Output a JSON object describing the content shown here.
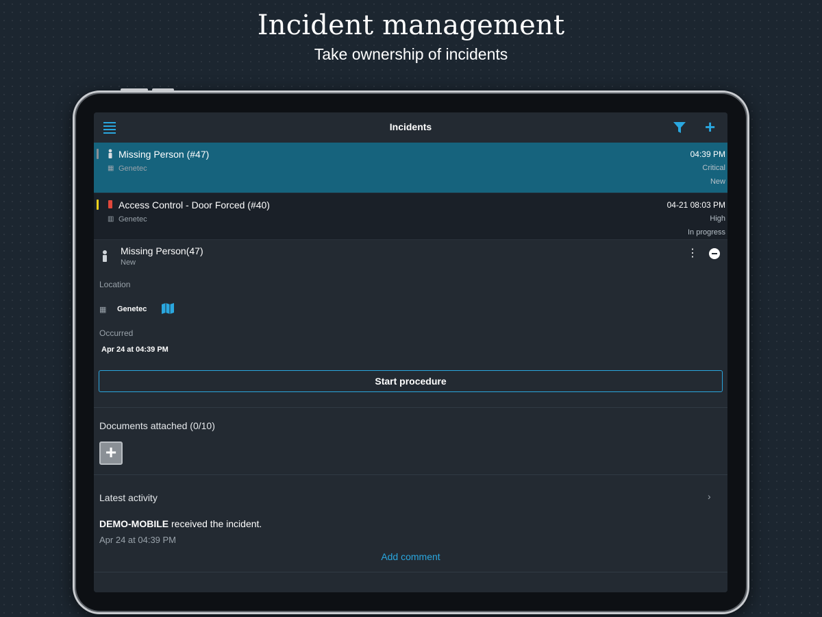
{
  "hero": {
    "title": "Incident management",
    "subtitle": "Take ownership of incidents"
  },
  "topbar": {
    "title": "Incidents",
    "icons": [
      "menu-icon",
      "filter-icon",
      "add-icon"
    ],
    "accent_color": "#2aa7df"
  },
  "incidents": [
    {
      "title": "Missing Person (#47)",
      "site": "Genetec",
      "time": "04:39 PM",
      "priority": "Critical",
      "state": "New",
      "selected": true,
      "priority_color": "#8a9096"
    },
    {
      "title": "Access Control - Door Forced  (#40)",
      "site": "Genetec",
      "time": "04-21 08:03 PM",
      "priority": "High",
      "state": "In progress",
      "selected": false,
      "priority_color": "#f2d21b"
    }
  ],
  "detail": {
    "title": "Missing Person(47)",
    "state": "New",
    "location_label": "Location",
    "location_value": "Genetec",
    "occurred_label": "Occurred",
    "occurred_value": "Apr 24 at 04:39 PM",
    "start_button": "Start procedure",
    "documents_label": "Documents attached (0/10)",
    "activity_label": "Latest activity",
    "activity_actor": "DEMO-MOBILE",
    "activity_text": " received the incident.",
    "activity_time": "Apr 24 at 04:39 PM",
    "add_comment": "Add comment"
  }
}
